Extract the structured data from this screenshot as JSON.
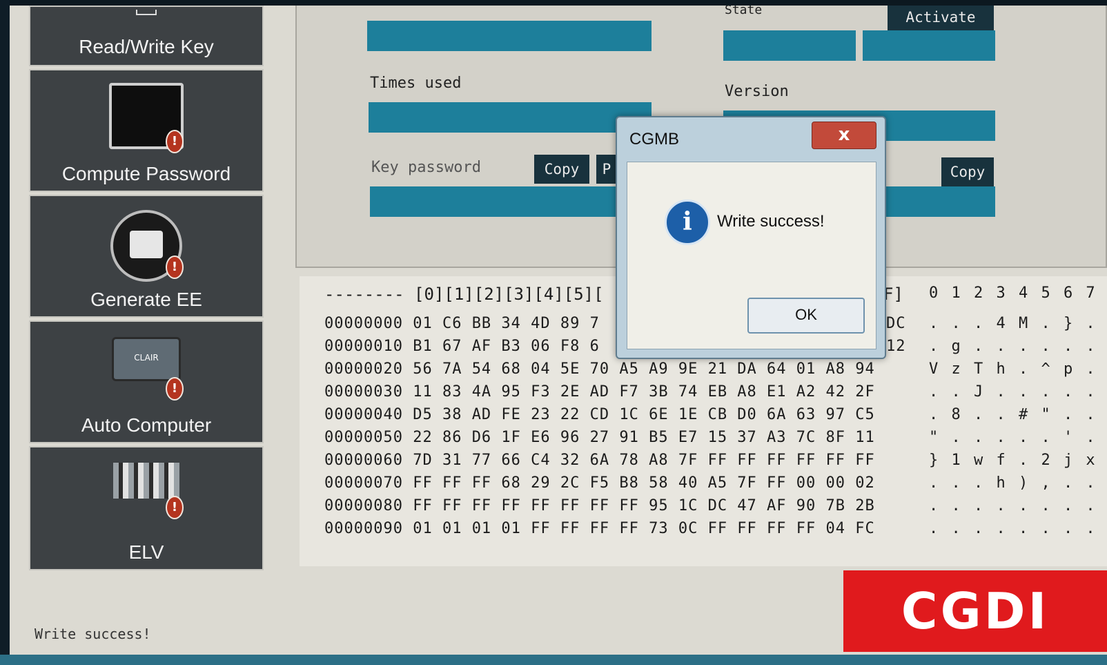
{
  "sidebar": {
    "items": [
      {
        "label": "Read/Write Key"
      },
      {
        "label": "Compute Password",
        "badge": "!"
      },
      {
        "label": "Generate EE",
        "badge": "!"
      },
      {
        "label": "Auto Computer",
        "badge": "!",
        "icon_text": "CLAIR"
      },
      {
        "label": "ELV",
        "badge": "!"
      }
    ]
  },
  "form": {
    "state_label": "State",
    "activate_label": "Activate",
    "times_used_label": "Times used",
    "version_label": "Version",
    "key_password_label": "Key password",
    "copy_label": "Copy",
    "copy_right_label": "Copy",
    "hidden_btn_fragment": "P"
  },
  "hex": {
    "header": "-------- [0][1][2][3][4][5][",
    "header_right": "F]",
    "ascii_header": "0 1 2 3 4 5 6 7",
    "rows": [
      {
        "addr": "00000000",
        "bytes": "01 C6 BB 34 4D 89 7",
        "tail": "DC",
        "ascii": ". . . 4 M . } ."
      },
      {
        "addr": "00000010",
        "bytes": "B1 67 AF B3 06 F8 6",
        "tail": "12",
        "ascii": ". g . . . . . ."
      },
      {
        "addr": "00000020",
        "bytes": "56 7A 54 68 04 5E 70 A5 A9 9E 21 DA 64 01 A8 94",
        "tail": "",
        "ascii": "V z T h . ^ p ."
      },
      {
        "addr": "00000030",
        "bytes": "11 83 4A 95 F3 2E AD F7 3B 74 EB A8 E1 A2 42 2F",
        "tail": "",
        "ascii": ". . J . . . . ."
      },
      {
        "addr": "00000040",
        "bytes": "D5 38 AD FE 23 22 CD 1C 6E 1E CB D0 6A 63 97 C5",
        "tail": "",
        "ascii": ". 8 . . # \" . ."
      },
      {
        "addr": "00000050",
        "bytes": "22 86 D6 1F E6 96 27 91 B5 E7 15 37 A3 7C 8F 11",
        "tail": "",
        "ascii": "\" . . . . . ' ."
      },
      {
        "addr": "00000060",
        "bytes": "7D 31 77 66 C4 32 6A 78 A8 7F FF FF FF FF FF FF",
        "tail": "",
        "ascii": "} 1 w f . 2 j x"
      },
      {
        "addr": "00000070",
        "bytes": "FF FF FF 68 29 2C F5 B8 58 40 A5 7F FF 00 00 02",
        "tail": "",
        "ascii": ". . . h ) , . ."
      },
      {
        "addr": "00000080",
        "bytes": "FF FF FF FF FF FF FF FF 95 1C DC 47 AF 90 7B 2B",
        "tail": "",
        "ascii": ". . . . . . . ."
      },
      {
        "addr": "00000090",
        "bytes": "01 01 01 01 FF FF FF FF 73 0C FF FF FF FF 04 FC",
        "tail": "",
        "ascii": ". . . . . . . ."
      }
    ]
  },
  "status": {
    "message": "Write success!"
  },
  "dialog": {
    "title": "CGMB",
    "close_glyph": "x",
    "message": "Write success!",
    "ok_label": "OK",
    "icon_glyph": "i"
  },
  "brand": {
    "text": "CGDI",
    "color": "#e01a1d"
  }
}
